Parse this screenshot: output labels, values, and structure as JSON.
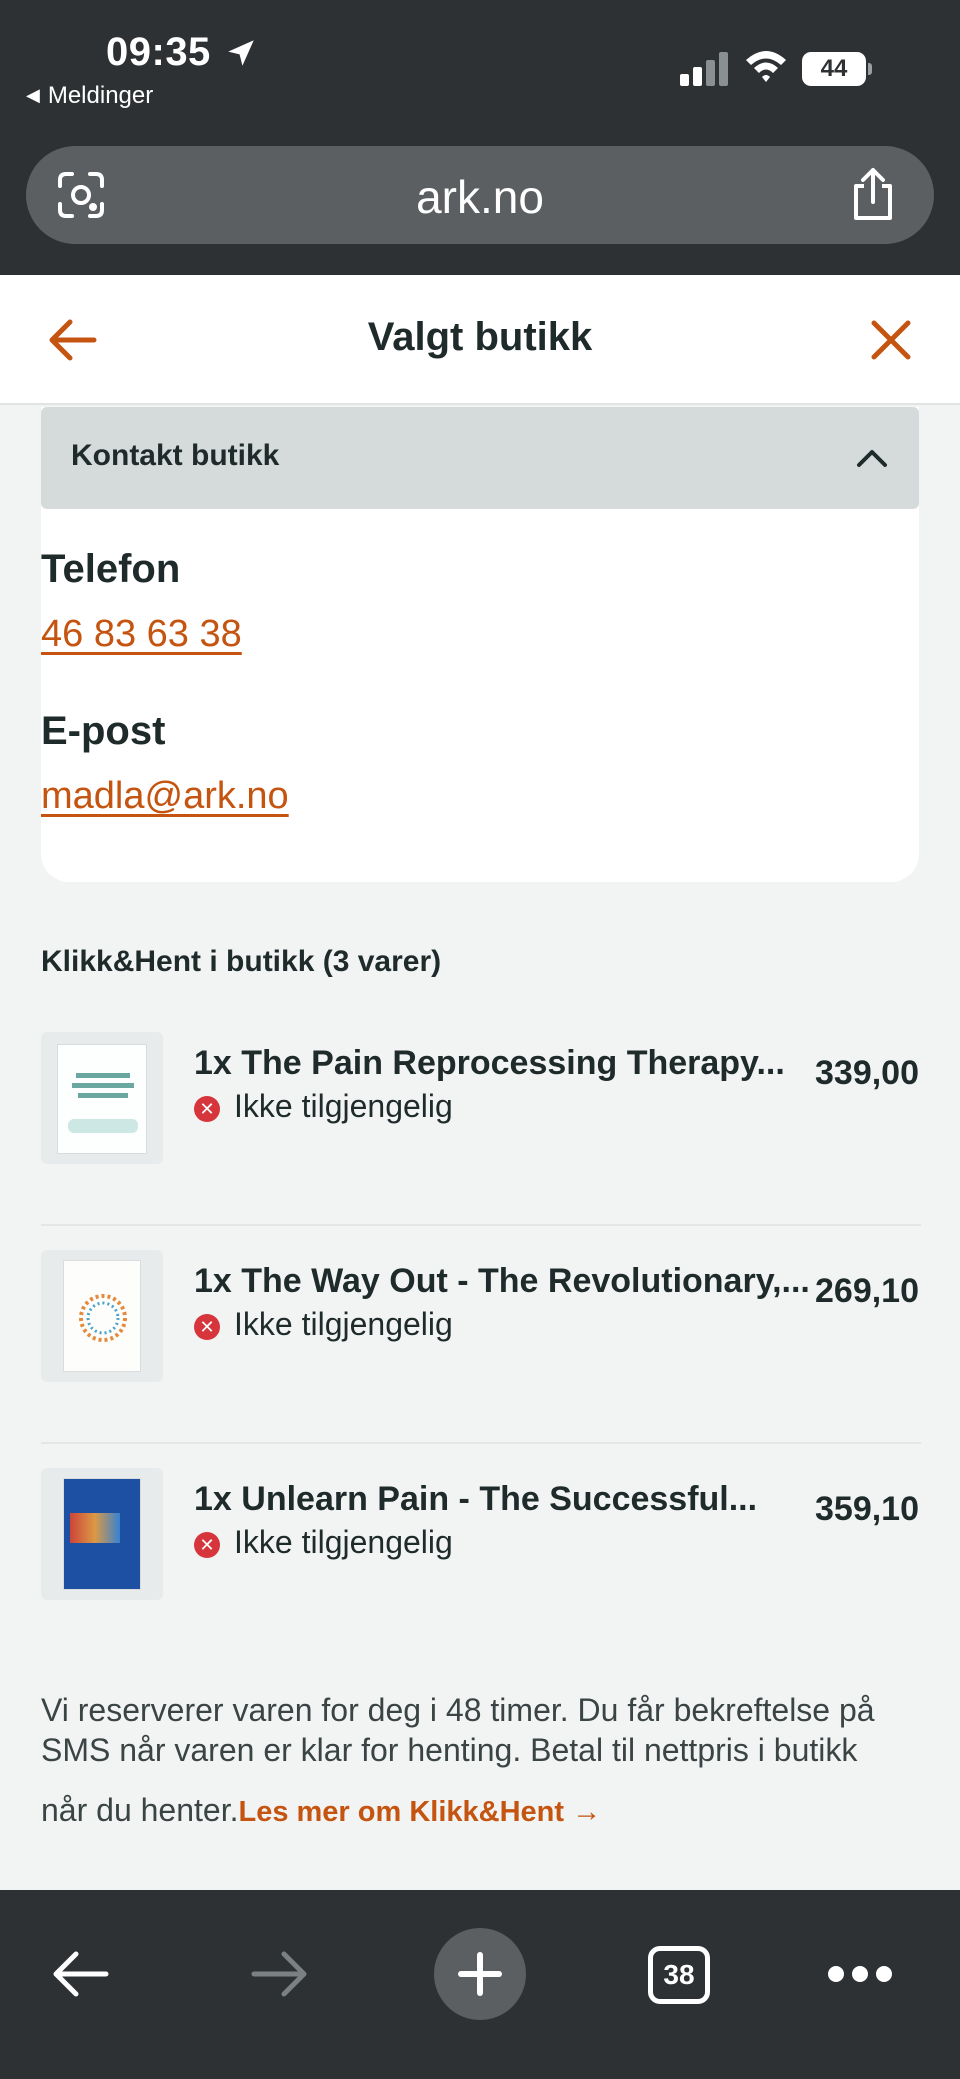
{
  "status_bar": {
    "time": "09:35",
    "back_app": "Meldinger",
    "battery": "44"
  },
  "browser": {
    "url": "ark.no",
    "tab_count": "38"
  },
  "header": {
    "title": "Valgt butikk"
  },
  "contact": {
    "accordion_label": "Kontakt butikk",
    "phone_label": "Telefon",
    "phone": "46 83 63 38",
    "email_label": "E-post",
    "email": "madla@ark.no"
  },
  "cart": {
    "section_title": "Klikk&Hent i butikk (3 varer)",
    "items": [
      {
        "title": "1x The Pain Reprocessing Therapy...",
        "status": "Ikke tilgjengelig",
        "price": "339,00"
      },
      {
        "title": "1x The Way Out - The Revolutionary,...",
        "status": "Ikke tilgjengelig",
        "price": "269,10"
      },
      {
        "title": "1x Unlearn Pain - The Successful...",
        "status": "Ikke tilgjengelig",
        "price": "359,10"
      }
    ]
  },
  "info": {
    "line1": "Vi reserverer varen for deg i 48 timer. Du får bekreftelse på",
    "line2": "SMS når varen er klar for henting. Betal til nettpris i butikk",
    "line3": "når du henter.",
    "link": "Les mer om Klikk&Hent"
  },
  "colors": {
    "accent": "#c4540f",
    "chrome": "#2d3133",
    "unavailable": "#d6363b"
  },
  "icons": [
    "location-arrow-icon",
    "signal-icon",
    "wifi-icon",
    "battery-icon",
    "lens-icon",
    "share-icon",
    "arrow-left-icon",
    "close-icon",
    "chevron-up-icon",
    "x-circle-icon",
    "arrow-right-icon",
    "plus-icon",
    "more-icon"
  ]
}
